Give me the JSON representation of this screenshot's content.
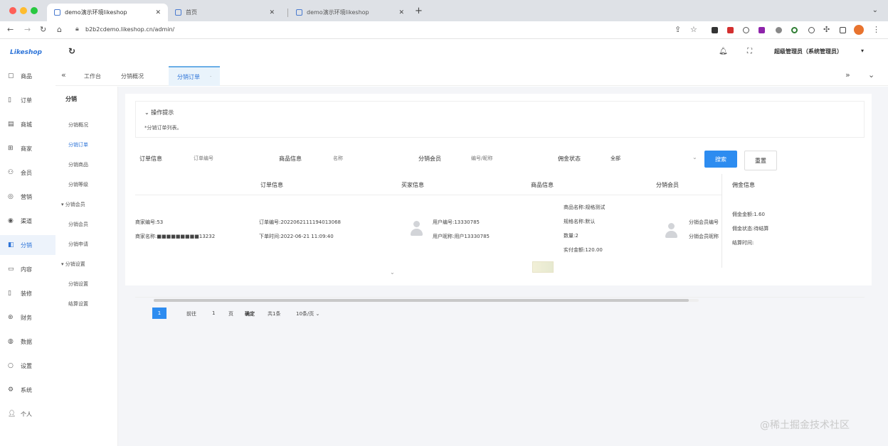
{
  "browser": {
    "tabs": [
      {
        "label": "demo演示环境likeshop"
      },
      {
        "label": "首页"
      },
      {
        "label": "demo演示环境likeshop"
      }
    ],
    "new_tab_symbol": "+",
    "url": "b2b2cdemo.likeshop.cn/admin/",
    "colors": {
      "profile": "#e8732e"
    }
  },
  "app": {
    "logo": "Likeshop",
    "user_label": "超级管理员（系统管理员）"
  },
  "sidebar": {
    "items": [
      {
        "label": "商品",
        "icon": "box-icon"
      },
      {
        "label": "订单",
        "icon": "order-icon"
      },
      {
        "label": "商城",
        "icon": "store-icon"
      },
      {
        "label": "商家",
        "icon": "merchant-icon"
      },
      {
        "label": "会员",
        "icon": "member-icon"
      },
      {
        "label": "营销",
        "icon": "marketing-icon"
      },
      {
        "label": "渠道",
        "icon": "channel-icon"
      },
      {
        "label": "分销",
        "icon": "distribution-icon"
      },
      {
        "label": "内容",
        "icon": "content-icon"
      },
      {
        "label": "装修",
        "icon": "decorate-icon"
      },
      {
        "label": "财务",
        "icon": "finance-icon"
      },
      {
        "label": "数据",
        "icon": "data-icon"
      },
      {
        "label": "设置",
        "icon": "settings-icon"
      },
      {
        "label": "系统",
        "icon": "system-icon"
      },
      {
        "label": "个人",
        "icon": "person-icon"
      }
    ],
    "active_index": 7
  },
  "topnav": {
    "tabs": [
      {
        "label": "工作台"
      },
      {
        "label": "分销概况"
      },
      {
        "label": "分销订单"
      }
    ],
    "active_index": 2
  },
  "subnav": {
    "title": "分销",
    "items": [
      {
        "label": "分销概况"
      },
      {
        "label": "分销订单"
      },
      {
        "label": "分销商品"
      },
      {
        "label": "分销等级"
      }
    ],
    "group1": "分销会员",
    "group1_items": [
      {
        "label": "分销会员"
      },
      {
        "label": "分销申请"
      }
    ],
    "group2": "分销设置",
    "group2_items": [
      {
        "label": "分销设置"
      },
      {
        "label": "结算设置"
      }
    ]
  },
  "tip": {
    "title": "操作提示",
    "text": "*分销订单列表。"
  },
  "filters": {
    "order_info_label": "订单信息",
    "order_info_placeholder": "订单编号",
    "goods_info_label": "商品信息",
    "goods_info_placeholder": "名称",
    "member_label": "分销会员",
    "member_placeholder": "编号/昵称",
    "status_label": "佣金状态",
    "status_value": "全部",
    "search_button": "搜索",
    "reset_button": "重置"
  },
  "table": {
    "headers": [
      "订单信息",
      "买家信息",
      "商品信息",
      "分销会员",
      "佣金信息"
    ],
    "rows": [
      {
        "shop_id": "商家编号:53",
        "shop_name": "商家名称:■■■■■■■■■13232",
        "order_no": "订单编号:2022062111194013068",
        "order_time": "下单时间:2022-06-21 11:09:40",
        "buyer_no": "用户编号:13330785",
        "buyer_name": "用户昵称:用户13330785",
        "goods_name": "商品名称:规格测试",
        "goods_spec": "规格名称:默认",
        "goods_qty": "数量:2",
        "goods_paid": "实付金额:120.00",
        "member_no": "分销会员编号",
        "member_name": "分销会员昵称",
        "commission_amount": "佣金金额:1.60",
        "commission_status": "佣金状态:待结算",
        "settle_time": "结算时间:"
      }
    ]
  },
  "pager": {
    "current": "1",
    "prev": "前往",
    "page_input": "1",
    "page_unit": "页",
    "confirm": "确定",
    "total": "共1条",
    "page_size": "10条/页"
  },
  "watermark": "@稀土掘金技术社区"
}
